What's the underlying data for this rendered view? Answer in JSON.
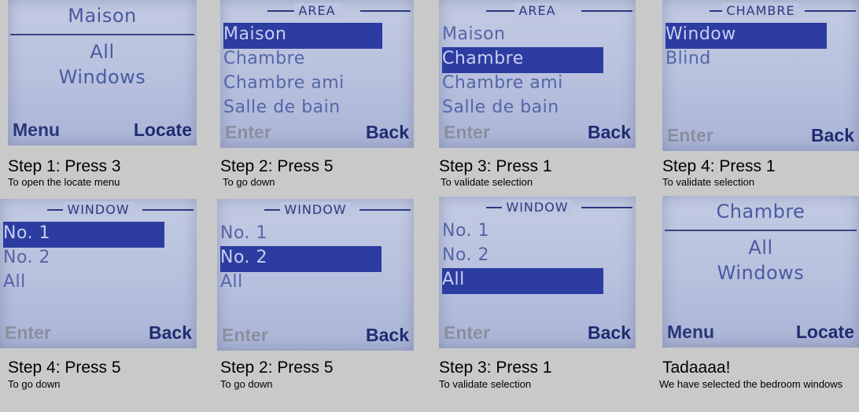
{
  "panels": [
    {
      "screen": {
        "top": "Maison",
        "line1": "All",
        "line2": "Windows",
        "left_key": "Menu",
        "right_key": "Locate"
      },
      "step": "Step 1: Press 3",
      "desc": "To open the locate menu"
    },
    {
      "screen": {
        "header": "AREA",
        "items": [
          "Maison",
          "Chambre",
          "Chambre ami",
          "Salle de bain"
        ],
        "selected": 0,
        "left_key": "Enter",
        "right_key": "Back"
      },
      "step": "Step 2: Press 5",
      "desc": "To go down"
    },
    {
      "screen": {
        "header": "AREA",
        "items": [
          "Maison",
          "Chambre",
          "Chambre ami",
          "Salle de bain"
        ],
        "selected": 1,
        "left_key": "Enter",
        "right_key": "Back"
      },
      "step": "Step 3: Press 1",
      "desc": "To validate selection"
    },
    {
      "screen": {
        "header": "CHAMBRE",
        "items": [
          "Window",
          "Blind"
        ],
        "selected": 0,
        "left_key": "Enter",
        "right_key": "Back"
      },
      "step": "Step 4: Press 1",
      "desc": "To validate selection"
    },
    {
      "screen": {
        "header": "WINDOW",
        "items": [
          "No. 1",
          "No. 2",
          "All"
        ],
        "selected": 0,
        "left_key": "Enter",
        "right_key": "Back"
      },
      "step": "Step 4: Press 5",
      "desc": "To go down"
    },
    {
      "screen": {
        "header": "WINDOW",
        "items": [
          "No. 1",
          "No. 2",
          "All"
        ],
        "selected": 1,
        "left_key": "Enter",
        "right_key": "Back"
      },
      "step": "Step 2: Press 5",
      "desc": "To go down"
    },
    {
      "screen": {
        "header": "WINDOW",
        "items": [
          "No. 1",
          "No. 2",
          "All"
        ],
        "selected": 2,
        "left_key": "Enter",
        "right_key": "Back"
      },
      "step": "Step 3: Press 1",
      "desc": "To validate selection"
    },
    {
      "screen": {
        "top": "Chambre",
        "line1": "All",
        "line2": "Windows",
        "left_key": "Menu",
        "right_key": "Locate"
      },
      "step": "Tadaaaa!",
      "desc": "We have selected the bedroom windows"
    }
  ],
  "colors": {
    "lcd_background": "#b7c0dd",
    "selection_bar": "#2c3ca0",
    "softkey": "#1f2c70",
    "page_background": "#c9c9c9"
  }
}
